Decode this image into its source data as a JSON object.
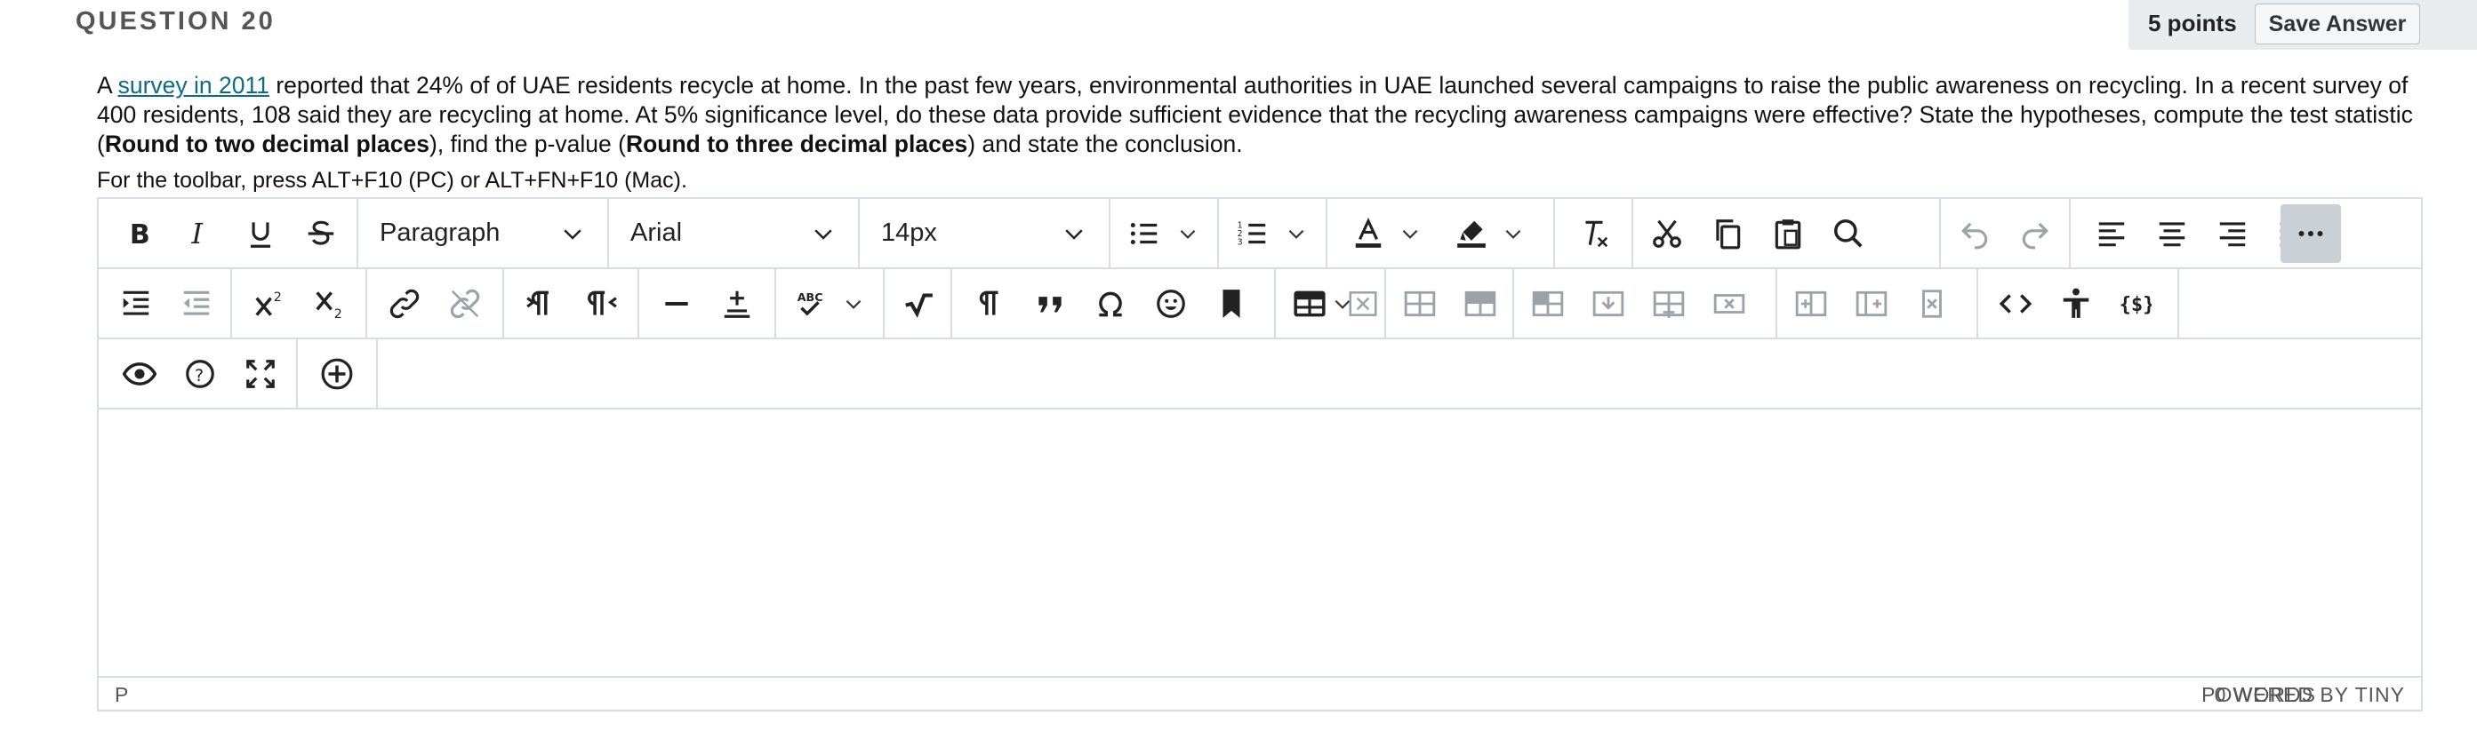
{
  "question": {
    "title": "QUESTION 20",
    "points": "5 points",
    "save_label": "Save Answer",
    "text_intro": "A ",
    "link_text": "survey in 2011",
    "text_p1": " reported that 24% of of UAE residents recycle at home. In the past few years, environmental authorities in UAE launched several campaigns to raise the public awareness on recycling. In a recent survey of 400 residents, 108 said they are recycling at home. At 5% significance level, do these data provide sufficient evidence that the recycling awareness campaigns were effective? State the hypotheses, compute the test statistic (",
    "bold1": "Round to two decimal places",
    "text_p2": "), find the p-value (",
    "bold2": "Round to three decimal places",
    "text_p3": ") and state the conclusion.",
    "toolbar_hint": "For the toolbar, press ALT+F10 (PC) or ALT+FN+F10 (Mac)."
  },
  "editor": {
    "block_format": "Paragraph",
    "font_family": "Arial",
    "font_size": "14px",
    "status_path": "P",
    "word_count": "0 WORDS",
    "powered_by": "POWERED BY TINY",
    "colors": {
      "border": "#d7dde2",
      "link": "#0f6a8a",
      "more_bg": "#c9d0d6",
      "header_bg": "#e8ecef"
    }
  }
}
